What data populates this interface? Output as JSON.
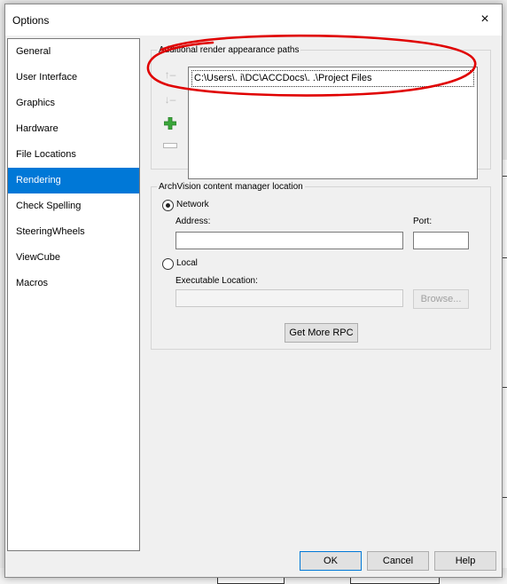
{
  "dialog": {
    "title": "Options",
    "close_glyph": "×"
  },
  "nav": {
    "items": [
      {
        "label": "General",
        "selected": false
      },
      {
        "label": "User Interface",
        "selected": false
      },
      {
        "label": "Graphics",
        "selected": false
      },
      {
        "label": "Hardware",
        "selected": false
      },
      {
        "label": "File Locations",
        "selected": false
      },
      {
        "label": "Rendering",
        "selected": true
      },
      {
        "label": "Check Spelling",
        "selected": false
      },
      {
        "label": "SteeringWheels",
        "selected": false
      },
      {
        "label": "ViewCube",
        "selected": false
      },
      {
        "label": "Macros",
        "selected": false
      }
    ]
  },
  "render_paths": {
    "group_label": "Additional render appearance paths",
    "paths": [
      "C:\\Users\\.                i\\DC\\ACCDocs\\.                .\\Project Files"
    ],
    "icons": {
      "up": "arrow-up-icon",
      "down": "arrow-down-icon",
      "add": "green-plus-icon",
      "remove": "minus-icon"
    }
  },
  "archvision": {
    "group_label": "ArchVision content manager location",
    "network_label": "Network",
    "network_selected": true,
    "address_label": "Address:",
    "address_value": "",
    "port_label": "Port:",
    "port_value": "",
    "local_label": "Local",
    "local_selected": false,
    "exec_label": "Executable Location:",
    "exec_value": "",
    "browse_label": "Browse...",
    "get_rpc_label": "Get More RPC"
  },
  "footer": {
    "ok_label": "OK",
    "cancel_label": "Cancel",
    "help_label": "Help"
  },
  "annotation": {
    "color": "#e00000"
  }
}
